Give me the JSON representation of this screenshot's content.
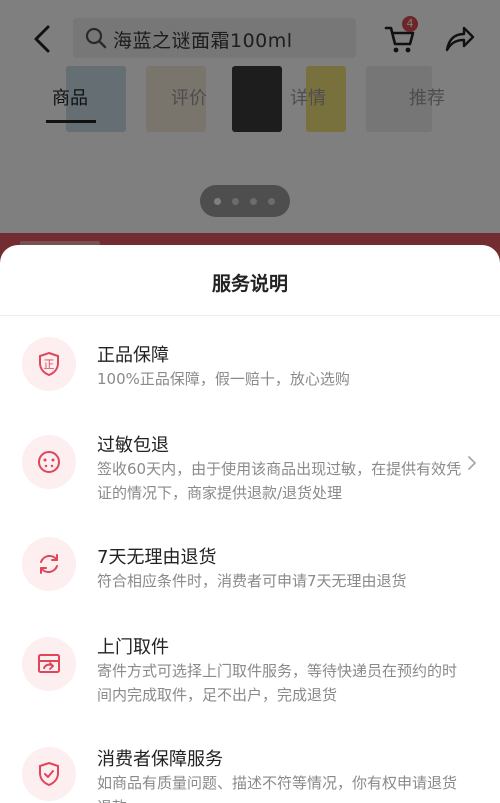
{
  "header": {
    "search_text": "海蓝之谜面霜100ml",
    "cart_badge": "4"
  },
  "tabs": [
    {
      "label": "商品",
      "active": true
    },
    {
      "label": "评价",
      "active": false
    },
    {
      "label": "详情",
      "active": false
    },
    {
      "label": "推荐",
      "active": false
    }
  ],
  "carousel": {
    "page_count": 4
  },
  "colors": {
    "accent": "#e0455a",
    "icon_bg": "#fdeef0",
    "promo_bar": "#e75b63"
  },
  "sheet": {
    "title": "服务说明",
    "items": [
      {
        "icon": "genuine-shield-icon",
        "title": "正品保障",
        "desc": "100%正品保障，假一赔十，放心选购"
      },
      {
        "icon": "allergy-face-icon",
        "title": "过敏包退",
        "desc": "签收60天内，由于使用该商品出现过敏，在提供有效凭证的情况下，商家提供退款/退货处理"
      },
      {
        "icon": "return-cycle-icon",
        "title": "7天无理由退货",
        "desc": "符合相应条件时，消费者可申请7天无理由退货"
      },
      {
        "icon": "pickup-box-icon",
        "title": "上门取件",
        "desc": "寄件方式可选择上门取件服务，等待快递员在预约的时间内完成取件，足不出户，完成退货"
      },
      {
        "icon": "consumer-protection-icon",
        "title": "消费者保障服务",
        "desc": "如商品有质量问题、描述不符等情况，你有权申请退货退款"
      }
    ]
  }
}
